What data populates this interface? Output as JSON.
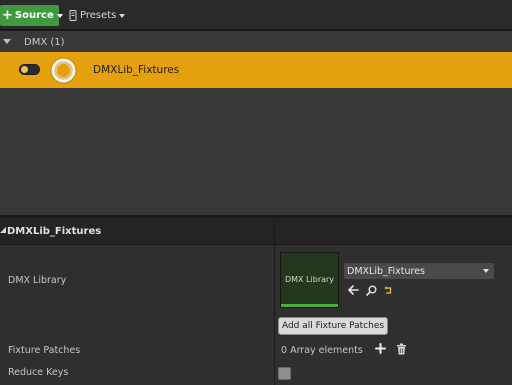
{
  "toolbar": {
    "source_label": "Source",
    "presets_label": "Presets"
  },
  "list": {
    "group_label": "DMX (1)",
    "fixture": {
      "name": "DMXLib_Fixtures",
      "enabled": true,
      "icon": "dmx-library-ring-icon"
    }
  },
  "details": {
    "header_title": "DMXLib_Fixtures",
    "dmx_library": {
      "label": "DMX Library",
      "thumbnail_text": "DMX Library",
      "asset_value": "DMXLib_Fixtures",
      "add_button_label": "Add all Fixture Patches"
    },
    "fixture_patches": {
      "label": "Fixture Patches",
      "value": "0 Array elements"
    },
    "reduce_keys": {
      "label": "Reduce Keys",
      "checked": false
    }
  },
  "colors": {
    "accent_selected_row": "#e5a00d",
    "source_button": "#3f9a3f",
    "panel_bg": "#383838",
    "details_bg": "#2f2f2f"
  }
}
